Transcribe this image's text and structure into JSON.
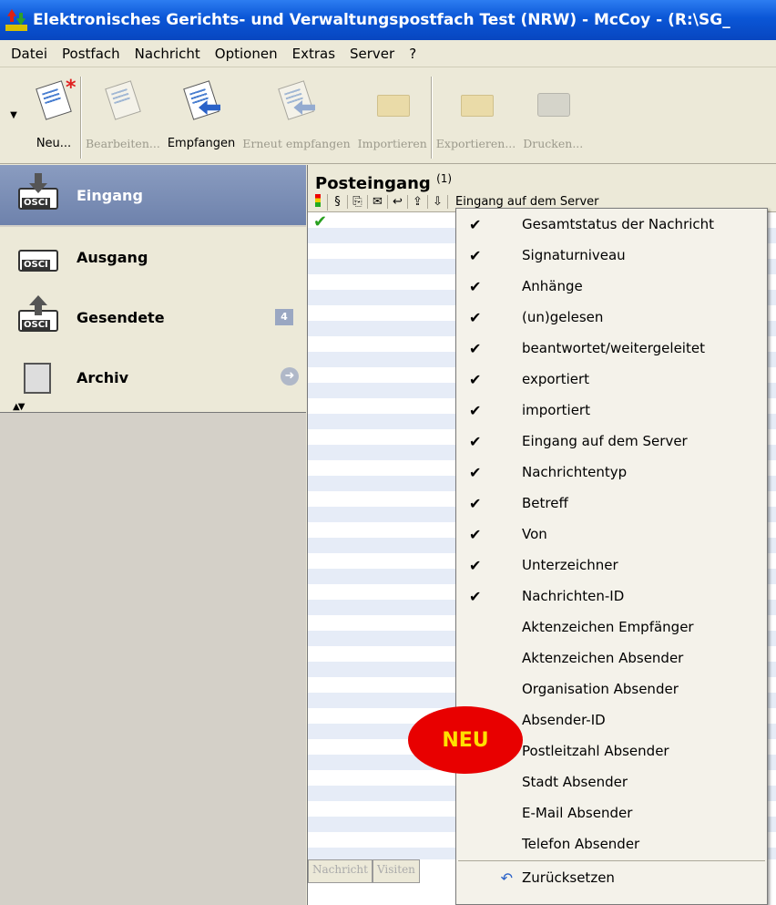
{
  "window": {
    "title": "Elektronisches Gerichts- und Verwaltungspostfach Test (NRW) - McCoy - (R:\\SG_"
  },
  "menubar": [
    "Datei",
    "Postfach",
    "Nachricht",
    "Optionen",
    "Extras",
    "Server",
    "?"
  ],
  "toolbar": {
    "neu": "Neu...",
    "bearbeiten": "Bearbeiten...",
    "empfangen": "Empfangen",
    "erneut": "Erneut empfangen",
    "importieren": "Importieren",
    "exportieren": "Exportieren...",
    "drucken": "Drucken..."
  },
  "nav": {
    "eingang": "Eingang",
    "ausgang": "Ausgang",
    "gesendete": "Gesendete",
    "gesendete_count": "4",
    "archiv": "Archiv"
  },
  "pane": {
    "title": "Posteingang",
    "count": "(1)",
    "col_last": "Eingang auf dem Server",
    "row1_status": "✔",
    "tab1": "Nachricht",
    "tab2": "Visiten"
  },
  "context_menu": {
    "items": [
      {
        "label": "Gesamtstatus der Nachricht",
        "checked": "✔"
      },
      {
        "label": "Signaturniveau",
        "checked": "✔"
      },
      {
        "label": "Anhänge",
        "checked": "✔"
      },
      {
        "label": "(un)gelesen",
        "checked": "✔"
      },
      {
        "label": "beantwortet/weitergeleitet",
        "checked": "✔"
      },
      {
        "label": "exportiert",
        "checked": "✔"
      },
      {
        "label": "importiert",
        "checked": "✔"
      },
      {
        "label": "Eingang auf dem Server",
        "checked": "✔"
      },
      {
        "label": "Nachrichtentyp",
        "checked": "✔"
      },
      {
        "label": "Betreff",
        "checked": "✔"
      },
      {
        "label": "Von",
        "checked": "✔"
      },
      {
        "label": "Unterzeichner",
        "checked": "✔"
      },
      {
        "label": "Nachrichten-ID",
        "checked": "✔"
      },
      {
        "label": "Aktenzeichen Empfänger",
        "checked": ""
      },
      {
        "label": "Aktenzeichen Absender",
        "checked": ""
      },
      {
        "label": "Organisation Absender",
        "checked": ""
      },
      {
        "label": "Absender-ID",
        "checked": ""
      },
      {
        "label": "Postleitzahl Absender",
        "checked": ""
      },
      {
        "label": "Stadt Absender",
        "checked": ""
      },
      {
        "label": "E-Mail Absender",
        "checked": ""
      },
      {
        "label": "Telefon Absender",
        "checked": ""
      }
    ],
    "reset": "Zurücksetzen"
  },
  "badge": {
    "neu": "NEU"
  }
}
